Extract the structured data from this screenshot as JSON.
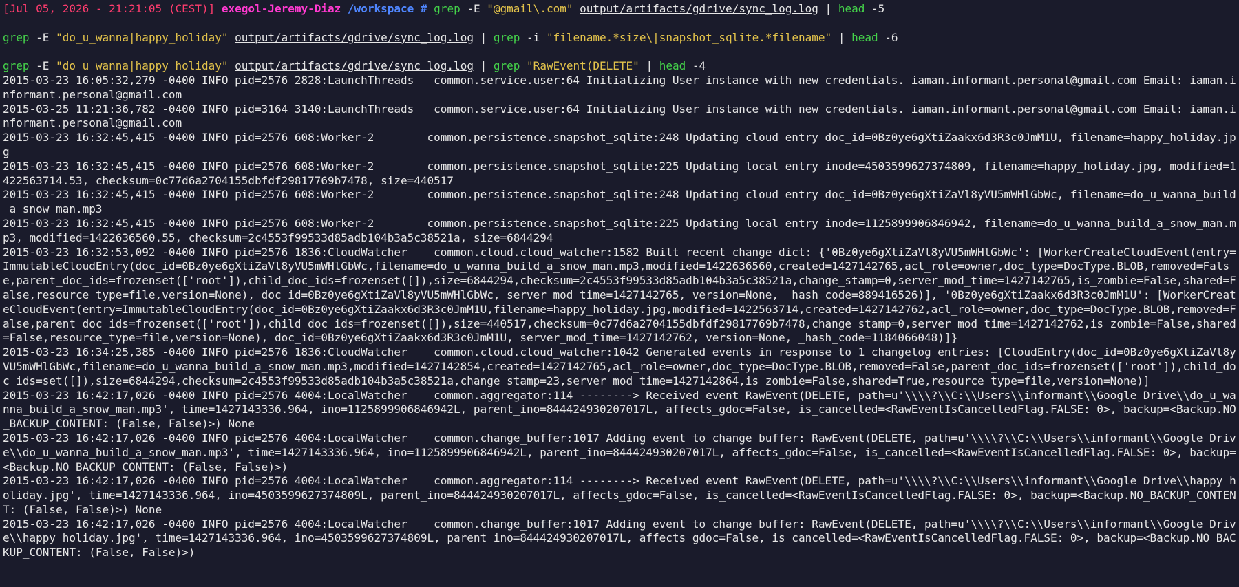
{
  "prompt": {
    "timestamp": "[Jul 05, 2026 - 21:21:05 (CEST)]",
    "user": "exegol-Jeremy-Diaz",
    "cwd": "/workspace",
    "symbol": "#"
  },
  "commands": [
    {
      "p1_cmd": "grep",
      "p1_flag": "-E",
      "p1_pattern": "\"@gmail\\.com\"",
      "p1_file": "output/artifacts/gdrive/sync_log.log",
      "pipe": "|",
      "p2_cmd": "head",
      "p2_arg": "-5"
    },
    {
      "p1_cmd": "grep",
      "p1_flag": "-E",
      "p1_pattern": "\"do_u_wanna|happy_holiday\"",
      "p1_file": "output/artifacts/gdrive/sync_log.log",
      "pipe": "|",
      "p2_cmd": "grep",
      "p2_flag": "-i",
      "p2_pattern": "\"filename.*size\\|snapshot_sqlite.*filename\"",
      "pipe2": "|",
      "p3_cmd": "head",
      "p3_arg": "-6"
    },
    {
      "p1_cmd": "grep",
      "p1_flag": "-E",
      "p1_pattern": "\"do_u_wanna|happy_holiday\"",
      "p1_file": "output/artifacts/gdrive/sync_log.log",
      "pipe": "|",
      "p2_cmd": "grep",
      "p2_pattern": "\"RawEvent(DELETE\"",
      "pipe2": "|",
      "p3_cmd": "head",
      "p3_arg": "-4"
    }
  ],
  "output": [
    "2015-03-23 16:05:32,279 -0400 INFO pid=2576 2828:LaunchThreads   common.service.user:64 Initializing User instance with new credentials. iaman.informant.personal@gmail.com Email: iaman.informant.personal@gmail.com",
    "2015-03-25 11:21:36,782 -0400 INFO pid=3164 3140:LaunchThreads   common.service.user:64 Initializing User instance with new credentials. iaman.informant.personal@gmail.com Email: iaman.informant.personal@gmail.com",
    "2015-03-23 16:32:45,415 -0400 INFO pid=2576 608:Worker-2        common.persistence.snapshot_sqlite:248 Updating cloud entry doc_id=0Bz0ye6gXtiZaakx6d3R3c0JmM1U, filename=happy_holiday.jpg",
    "2015-03-23 16:32:45,415 -0400 INFO pid=2576 608:Worker-2        common.persistence.snapshot_sqlite:225 Updating local entry inode=4503599627374809, filename=happy_holiday.jpg, modified=1422563714.53, checksum=0c77d6a2704155dbfdf29817769b7478, size=440517",
    "2015-03-23 16:32:45,415 -0400 INFO pid=2576 608:Worker-2        common.persistence.snapshot_sqlite:248 Updating cloud entry doc_id=0Bz0ye6gXtiZaVl8yVU5mWHlGbWc, filename=do_u_wanna_build_a_snow_man.mp3",
    "2015-03-23 16:32:45,415 -0400 INFO pid=2576 608:Worker-2        common.persistence.snapshot_sqlite:225 Updating local entry inode=1125899906846942, filename=do_u_wanna_build_a_snow_man.mp3, modified=1422636560.55, checksum=2c4553f99533d85adb104b3a5c38521a, size=6844294",
    "2015-03-23 16:32:53,092 -0400 INFO pid=2576 1836:CloudWatcher    common.cloud.cloud_watcher:1582 Built recent change dict: {'0Bz0ye6gXtiZaVl8yVU5mWHlGbWc': [WorkerCreateCloudEvent(entry=ImmutableCloudEntry(doc_id=0Bz0ye6gXtiZaVl8yVU5mWHlGbWc,filename=do_u_wanna_build_a_snow_man.mp3,modified=1422636560,created=1427142765,acl_role=owner,doc_type=DocType.BLOB,removed=False,parent_doc_ids=frozenset(['root']),child_doc_ids=frozenset([]),size=6844294,checksum=2c4553f99533d85adb104b3a5c38521a,change_stamp=0,server_mod_time=1427142765,is_zombie=False,shared=False,resource_type=file,version=None), doc_id=0Bz0ye6gXtiZaVl8yVU5mWHlGbWc, server_mod_time=1427142765, version=None, _hash_code=889416526)], '0Bz0ye6gXtiZaakx6d3R3c0JmM1U': [WorkerCreateCloudEvent(entry=ImmutableCloudEntry(doc_id=0Bz0ye6gXtiZaakx6d3R3c0JmM1U,filename=happy_holiday.jpg,modified=1422563714,created=1427142762,acl_role=owner,doc_type=DocType.BLOB,removed=False,parent_doc_ids=frozenset(['root']),child_doc_ids=frozenset([]),size=440517,checksum=0c77d6a2704155dbfdf29817769b7478,change_stamp=0,server_mod_time=1427142762,is_zombie=False,shared=False,resource_type=file,version=None), doc_id=0Bz0ye6gXtiZaakx6d3R3c0JmM1U, server_mod_time=1427142762, version=None, _hash_code=1184066048)]}",
    "2015-03-23 16:34:25,385 -0400 INFO pid=2576 1836:CloudWatcher    common.cloud.cloud_watcher:1042 Generated events in response to 1 changelog entries: [CloudEntry(doc_id=0Bz0ye6gXtiZaVl8yVU5mWHlGbWc,filename=do_u_wanna_build_a_snow_man.mp3,modified=1427142854,created=1427142765,acl_role=owner,doc_type=DocType.BLOB,removed=False,parent_doc_ids=frozenset(['root']),child_doc_ids=set([]),size=6844294,checksum=2c4553f99533d85adb104b3a5c38521a,change_stamp=23,server_mod_time=1427142864,is_zombie=False,shared=True,resource_type=file,version=None)]",
    "2015-03-23 16:42:17,026 -0400 INFO pid=2576 4004:LocalWatcher    common.aggregator:114 --------> Received event RawEvent(DELETE, path=u'\\\\\\\\?\\\\C:\\\\Users\\\\informant\\\\Google Drive\\\\do_u_wanna_build_a_snow_man.mp3', time=1427143336.964, ino=1125899906846942L, parent_ino=844424930207017L, affects_gdoc=False, is_cancelled=<RawEventIsCancelledFlag.FALSE: 0>, backup=<Backup.NO_BACKUP_CONTENT: (False, False)>) None",
    "2015-03-23 16:42:17,026 -0400 INFO pid=2576 4004:LocalWatcher    common.change_buffer:1017 Adding event to change buffer: RawEvent(DELETE, path=u'\\\\\\\\?\\\\C:\\\\Users\\\\informant\\\\Google Drive\\\\do_u_wanna_build_a_snow_man.mp3', time=1427143336.964, ino=1125899906846942L, parent_ino=844424930207017L, affects_gdoc=False, is_cancelled=<RawEventIsCancelledFlag.FALSE: 0>, backup=<Backup.NO_BACKUP_CONTENT: (False, False)>)",
    "2015-03-23 16:42:17,026 -0400 INFO pid=2576 4004:LocalWatcher    common.aggregator:114 --------> Received event RawEvent(DELETE, path=u'\\\\\\\\?\\\\C:\\\\Users\\\\informant\\\\Google Drive\\\\happy_holiday.jpg', time=1427143336.964, ino=4503599627374809L, parent_ino=844424930207017L, affects_gdoc=False, is_cancelled=<RawEventIsCancelledFlag.FALSE: 0>, backup=<Backup.NO_BACKUP_CONTENT: (False, False)>) None",
    "2015-03-23 16:42:17,026 -0400 INFO pid=2576 4004:LocalWatcher    common.change_buffer:1017 Adding event to change buffer: RawEvent(DELETE, path=u'\\\\\\\\?\\\\C:\\\\Users\\\\informant\\\\Google Drive\\\\happy_holiday.jpg', time=1427143336.964, ino=4503599627374809L, parent_ino=844424930207017L, affects_gdoc=False, is_cancelled=<RawEventIsCancelledFlag.FALSE: 0>, backup=<Backup.NO_BACKUP_CONTENT: (False, False)>)"
  ],
  "colors": {
    "background": "#1a1b2b",
    "timestamp": "#ff3c6e",
    "user": "#ff3ad0",
    "path": "#4f86ff",
    "command": "#44d24a",
    "string": "#e3c34b",
    "text": "#e6e6e6"
  }
}
